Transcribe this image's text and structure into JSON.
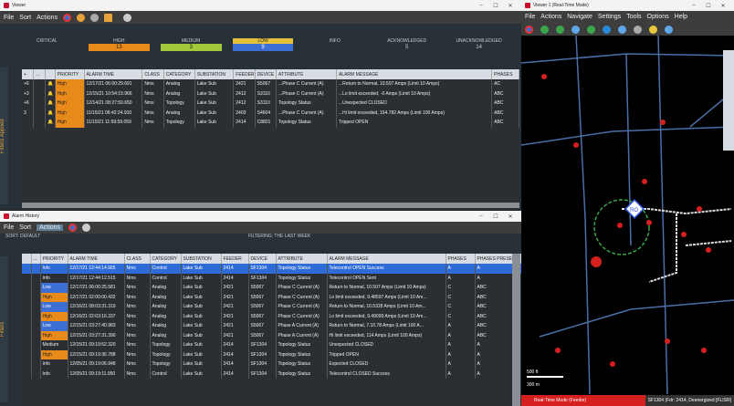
{
  "viewer": {
    "title": "Viewer",
    "menu": [
      "File",
      "Sort",
      "Actions"
    ],
    "severities": [
      {
        "label": "CRITICAL",
        "count": ""
      },
      {
        "label": "HIGH",
        "count": "13"
      },
      {
        "label": "MEDIUM",
        "count": "3"
      },
      {
        "label": "LOW",
        "count": "9"
      },
      {
        "label": "INFO",
        "count": ""
      },
      {
        "label": "ACKNOWLEDGED",
        "count": "5"
      },
      {
        "label": "UNACKNOWLEDGED",
        "count": "14"
      }
    ],
    "side_label": "Filters Applied",
    "columns": [
      "+",
      "...",
      "",
      "PRIORITY",
      "ALARM TIME",
      "CLASS",
      "CATEGORY",
      "SUBSTATION",
      "FEEDER",
      "DEVICE",
      "ATTRIBUTE",
      "ALARM MESSAGE",
      "PHASES"
    ],
    "rows": [
      [
        "+6",
        "",
        "High",
        "12/17/21 06:00:29.691",
        "Nms",
        "Analog",
        "Lake Sub",
        "2421",
        "S5067",
        "...Phase C Current (A)",
        "...Return to Normal, 10.507 Amps (Limit 10 Amps)",
        "AC"
      ],
      [
        "+3",
        "",
        "High",
        "12/15/21 10:54:19.966",
        "Nms",
        "Analog",
        "Lake Sub",
        "2412",
        "S3110",
        "...Phase C Current (A)",
        "...Lo limit exceeded, -0 Amps (Limit 10 Amps)",
        "ABC"
      ],
      [
        "+6",
        "",
        "High",
        "12/14/21 08:27:59.650",
        "Nms",
        "Topology",
        "Lake Sub",
        "2412",
        "S3110",
        "Topology Status",
        "...Unexpected CLOSED",
        "ABC"
      ],
      [
        "3",
        "",
        "High",
        "11/15/21 06:42:24.910",
        "Nms",
        "Analog",
        "Lake Sub",
        "2403",
        "S4604",
        "...Phase C Current (A)",
        "...Hi limit exceeded, 154.782 Amps (Limit 100 Amps)",
        "ABC"
      ],
      [
        "",
        "",
        "High",
        "11/15/21 11:59:59.059",
        "Nms",
        "Topology",
        "Lake Sub",
        "2414",
        "C8801",
        "Topology Status",
        "Tripped OPEN",
        "ABC"
      ]
    ]
  },
  "history": {
    "title": "Alarm History",
    "menu": [
      "File",
      "Sort",
      "Actions"
    ],
    "sort_label": "SORT: DEFAULT",
    "filter_label": "FILTERING: THE LAST WEEK",
    "side_label": "Filters",
    "columns": [
      "",
      "...",
      "PRIORITY",
      "ALARM TIME",
      "CLASS",
      "CATEGORY",
      "SUBSTATION",
      "FEEDER",
      "DEVICE",
      "ATTRIBUTE",
      "ALARM MESSAGE",
      "PHASES",
      "PHASES PRESE..."
    ],
    "rows": [
      [
        "",
        "",
        "Info",
        "12/17/21 12:44:14.665",
        "Nms",
        "Control",
        "Lake Sub",
        "2414",
        "SF1304",
        "Topology Status",
        "Telecontrol OPEN Success",
        "A",
        "A"
      ],
      [
        "",
        "",
        "Info",
        "12/17/21 12:44:12.515",
        "Nms",
        "Control",
        "Lake Sub",
        "2414",
        "SF1304",
        "Topology Status",
        "Telecontrol OPEN Sent",
        "A",
        "A"
      ],
      [
        "",
        "",
        "Low",
        "12/17/21 06:00:25.581",
        "Nms",
        "Analog",
        "Lake Sub",
        "2421",
        "S5067",
        "Phase C Current (A)",
        "Return to Normal, 10.507 Amps (Limit 10 Amps)",
        "C",
        "ABC"
      ],
      [
        "",
        "",
        "High",
        "12/17/21 02:00:00.432",
        "Nms",
        "Analog",
        "Lake Sub",
        "2421",
        "S5067",
        "Phase C Current (A)",
        "Lo limit exceeded, 9.48597 Amps (Limit 10 Am...",
        "C",
        "ABC"
      ],
      [
        "",
        "",
        "Low",
        "12/16/21 08:03:31.319",
        "Nms",
        "Analog",
        "Lake Sub",
        "2421",
        "S5067",
        "Phase C Current (A)",
        "Return to Normal, 10.5328 Amps (Limit 10 Am...",
        "C",
        "ABC"
      ],
      [
        "",
        "",
        "High",
        "12/16/21 02:03:16.337",
        "Nms",
        "Analog",
        "Lake Sub",
        "2421",
        "S5067",
        "Phase C Current (A)",
        "Lo limit exceeded, 9.49099 Amps (Limit 10 Am...",
        "C",
        "ABC"
      ],
      [
        "",
        "",
        "Low",
        "12/15/21 03:27:40.983",
        "Nms",
        "Analog",
        "Lake Sub",
        "2421",
        "S5067",
        "Phase A Current (A)",
        "Return to Normal, 7.10.78 Amps (Limit 100 A...",
        "A",
        "ABC"
      ],
      [
        "",
        "",
        "High",
        "12/15/21 03:27:31.390",
        "Nms",
        "Analog",
        "Lake Sub",
        "2421",
        "S5067",
        "Phase A Current (A)",
        "Hi limit exceeded, 114 Amps (Limit 100 Amps)",
        "A",
        "ABC"
      ],
      [
        "",
        "",
        "Medium",
        "12/15/21 09:19:52.320",
        "Nms",
        "Topology",
        "Lake Sub",
        "2414",
        "SF1304",
        "Topology Status",
        "Unexpected CLOSED",
        "A",
        "A"
      ],
      [
        "",
        "",
        "High",
        "12/15/21 09:19:36.788",
        "Nms",
        "Topology",
        "Lake Sub",
        "2414",
        "SF1304",
        "Topology Status",
        "Tripped OPEN",
        "A",
        "A"
      ],
      [
        "",
        "",
        "Info",
        "12/05/21 09:19:06.948",
        "Nms",
        "Topology",
        "Lake Sub",
        "2414",
        "SF1304",
        "Topology Status",
        "Expected CLOSED",
        "A",
        "A"
      ],
      [
        "",
        "",
        "Info",
        "12/05/21 09:19:11.950",
        "Nms",
        "Control",
        "Lake Sub",
        "2414",
        "SF1304",
        "Topology Status",
        "Telecontrol CLOSED Success",
        "A",
        "A"
      ]
    ]
  },
  "map": {
    "title": "Viewer 1 (Real-Time Mode)",
    "menu": [
      "File",
      "Actions",
      "Navigate",
      "Settings",
      "Tools",
      "Options",
      "Help"
    ],
    "status_mode": "Real-Time Mode (Feeder)",
    "status_info": "SF1304 (Fdr: 2414, Deenergized [FLISR]",
    "marker": "RO",
    "scale_labels": [
      "500 ft",
      "300 m"
    ]
  },
  "colors": {
    "high": "#e88a1a",
    "medium": "#a3c93a",
    "low": "#3b6fd4",
    "selected": "#2d6cd6"
  }
}
